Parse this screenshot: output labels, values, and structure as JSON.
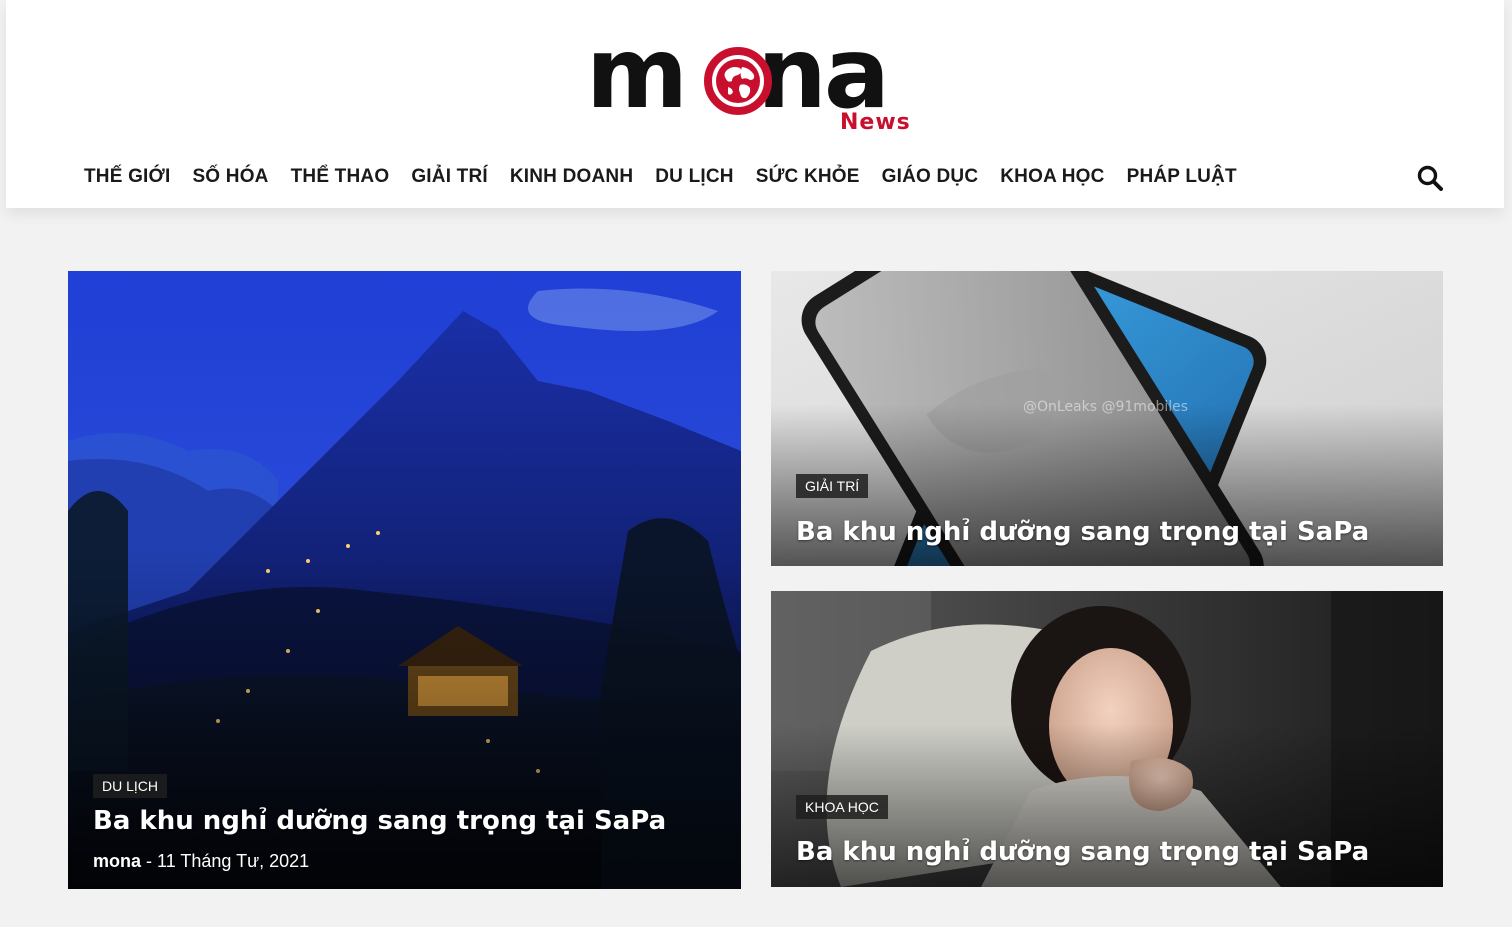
{
  "header": {
    "logo_word_left": "m",
    "logo_word_right": "na",
    "logo_sub": "News"
  },
  "nav": {
    "items": [
      "THẾ GIỚI",
      "SỐ HÓA",
      "THỂ THAO",
      "GIẢI TRÍ",
      "KINH DOANH",
      "DU LỊCH",
      "SỨC KHỎE",
      "GIÁO DỤC",
      "KHOA HỌC",
      "PHÁP LUẬT"
    ]
  },
  "colors": {
    "brand_red": "#c8102e",
    "text_dark": "#1a1a1a",
    "badge_bg": "#1e1e1e"
  },
  "featured": {
    "category": "DU LỊCH",
    "title": "Ba khu nghỉ dưỡng sang trọng tại SaPa",
    "author": "mona",
    "separator": " - ",
    "date": "11 Tháng Tư, 2021"
  },
  "side_posts": [
    {
      "category": "GIẢI TRÍ",
      "title": "Ba khu nghỉ dưỡng sang trọng tại SaPa",
      "watermark": "@OnLeaks  @91mobiles"
    },
    {
      "category": "KHOA HỌC",
      "title": "Ba khu nghỉ dưỡng sang trọng tại SaPa"
    }
  ]
}
